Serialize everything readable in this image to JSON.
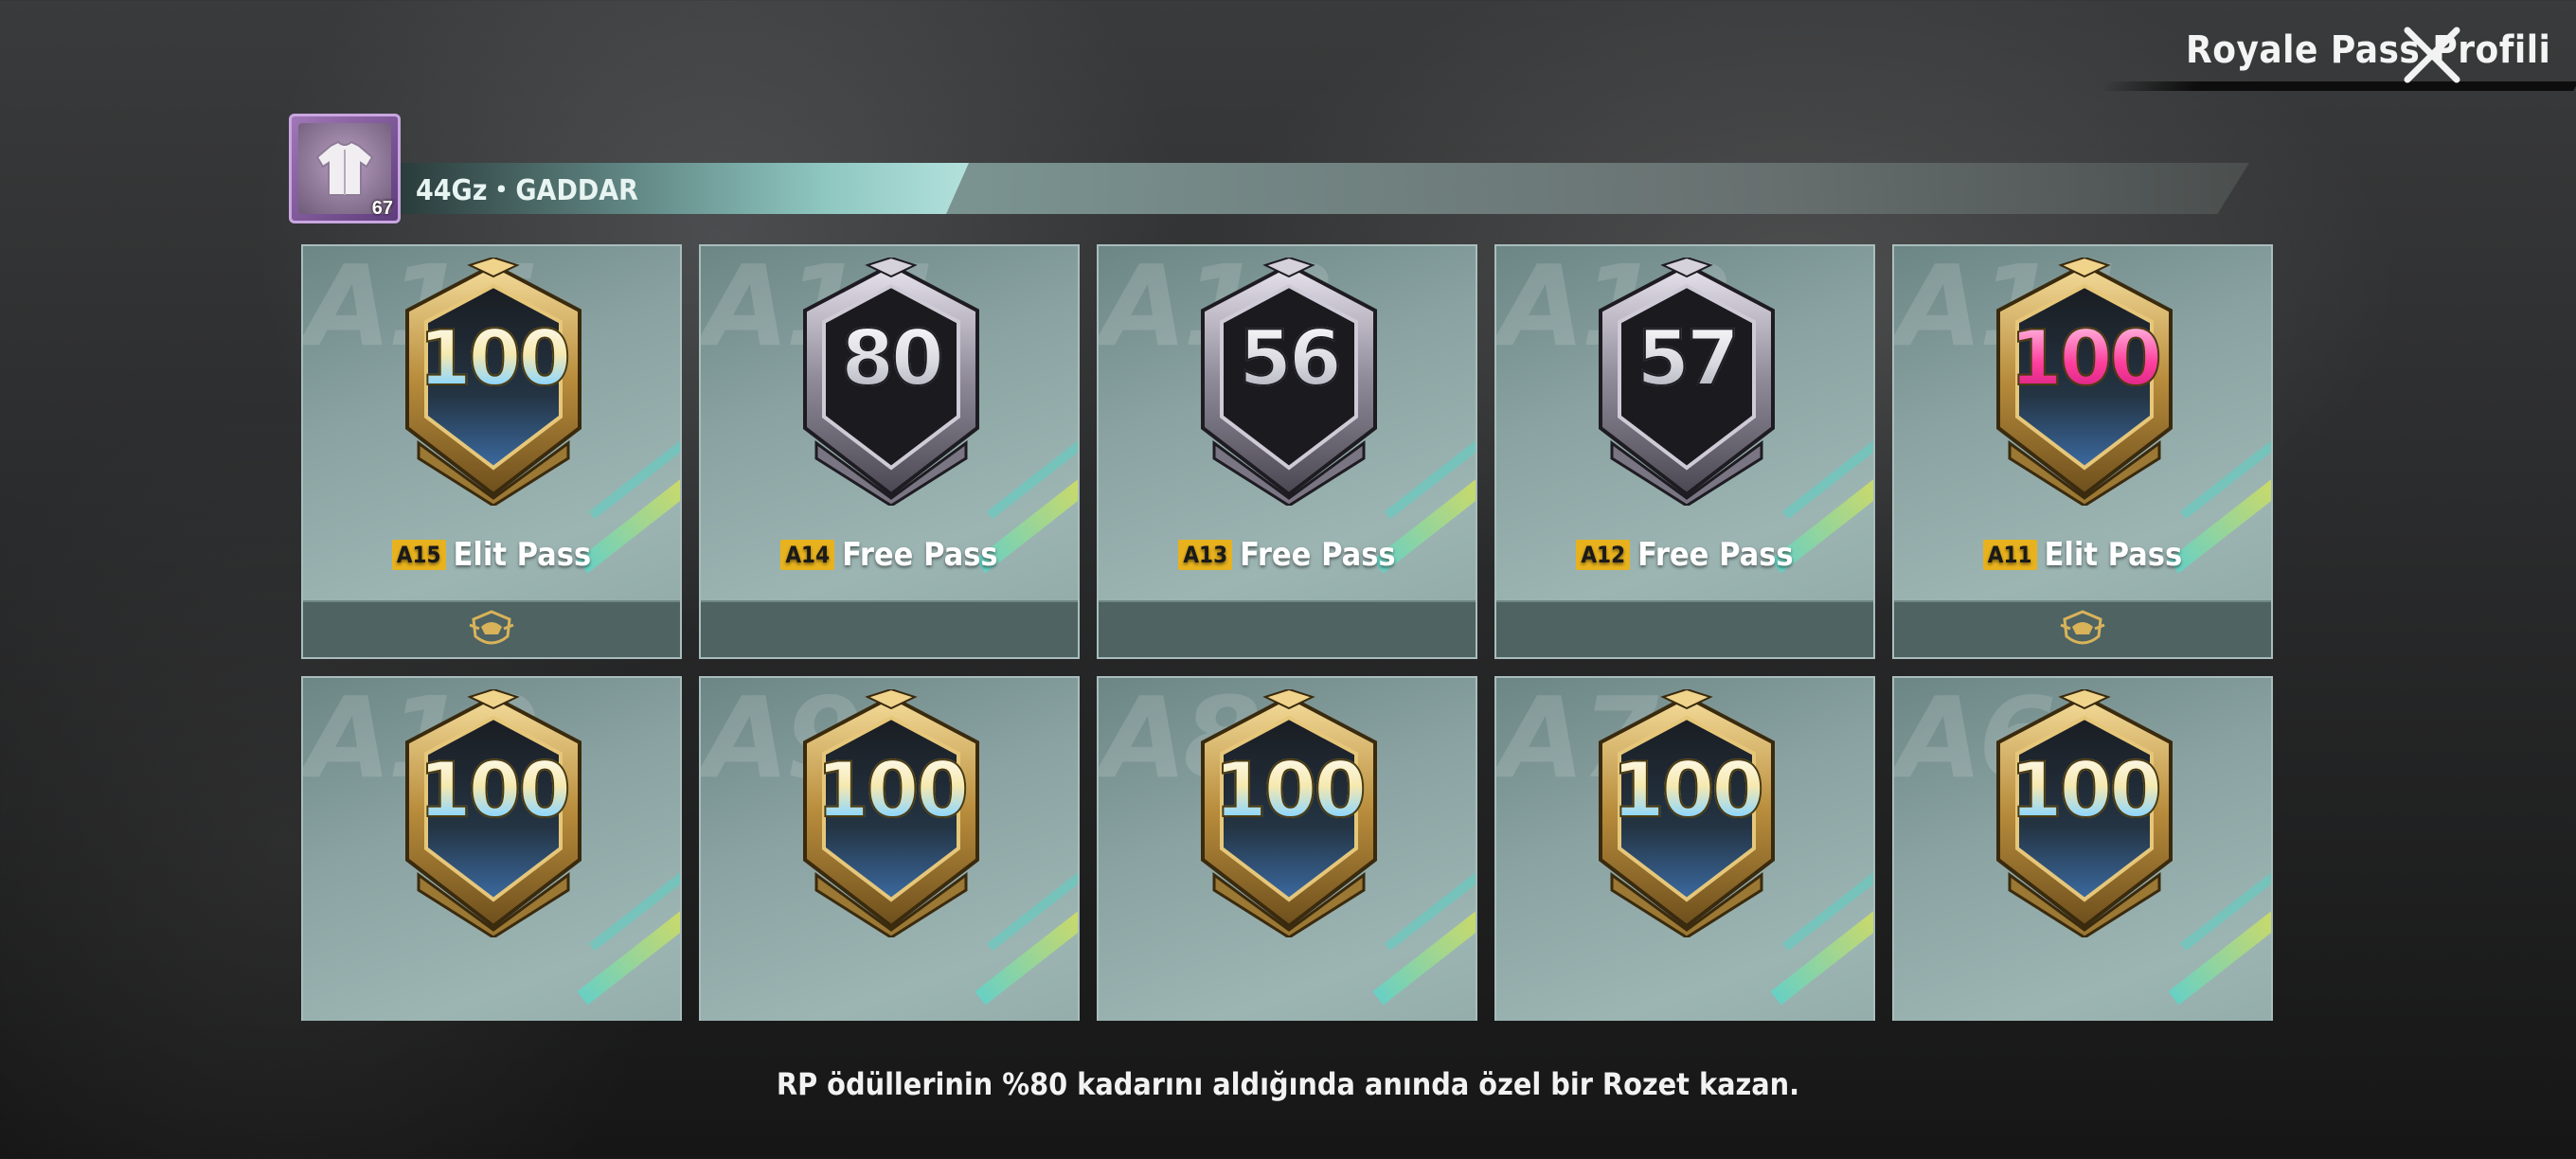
{
  "header": {
    "title": "Royale Pass Profili"
  },
  "profile": {
    "avatar_level": "67",
    "name": "44Gz・GADDAR"
  },
  "colors": {
    "gold": "#c8a24a",
    "silver": "#9a98a4",
    "card": "#8aa3a2",
    "season_tag": "#e8b21e",
    "stripe": "#5fd5c8"
  },
  "cards": [
    {
      "bg": "A15",
      "number": "100",
      "tag": "A15",
      "pass": "Elit Pass",
      "style": "gold",
      "elite_icon": true
    },
    {
      "bg": "A14",
      "number": "80",
      "tag": "A14",
      "pass": "Free Pass",
      "style": "silver",
      "elite_icon": false
    },
    {
      "bg": "A13",
      "number": "56",
      "tag": "A13",
      "pass": "Free Pass",
      "style": "silver",
      "elite_icon": false
    },
    {
      "bg": "A12",
      "number": "57",
      "tag": "A12",
      "pass": "Free Pass",
      "style": "silver",
      "elite_icon": false
    },
    {
      "bg": "A11",
      "number": "100",
      "tag": "A11",
      "pass": "Elit Pass",
      "style": "gold pink",
      "elite_icon": true
    },
    {
      "bg": "A10",
      "number": "100",
      "style": "gold"
    },
    {
      "bg": "A9",
      "number": "100",
      "style": "gold"
    },
    {
      "bg": "A8",
      "number": "100",
      "style": "gold"
    },
    {
      "bg": "A7",
      "number": "100",
      "style": "gold"
    },
    {
      "bg": "A6",
      "number": "100",
      "style": "gold"
    }
  ],
  "footer": {
    "info": "RP ödüllerinin %80 kadarını aldığında anında özel bir Rozet kazan."
  }
}
